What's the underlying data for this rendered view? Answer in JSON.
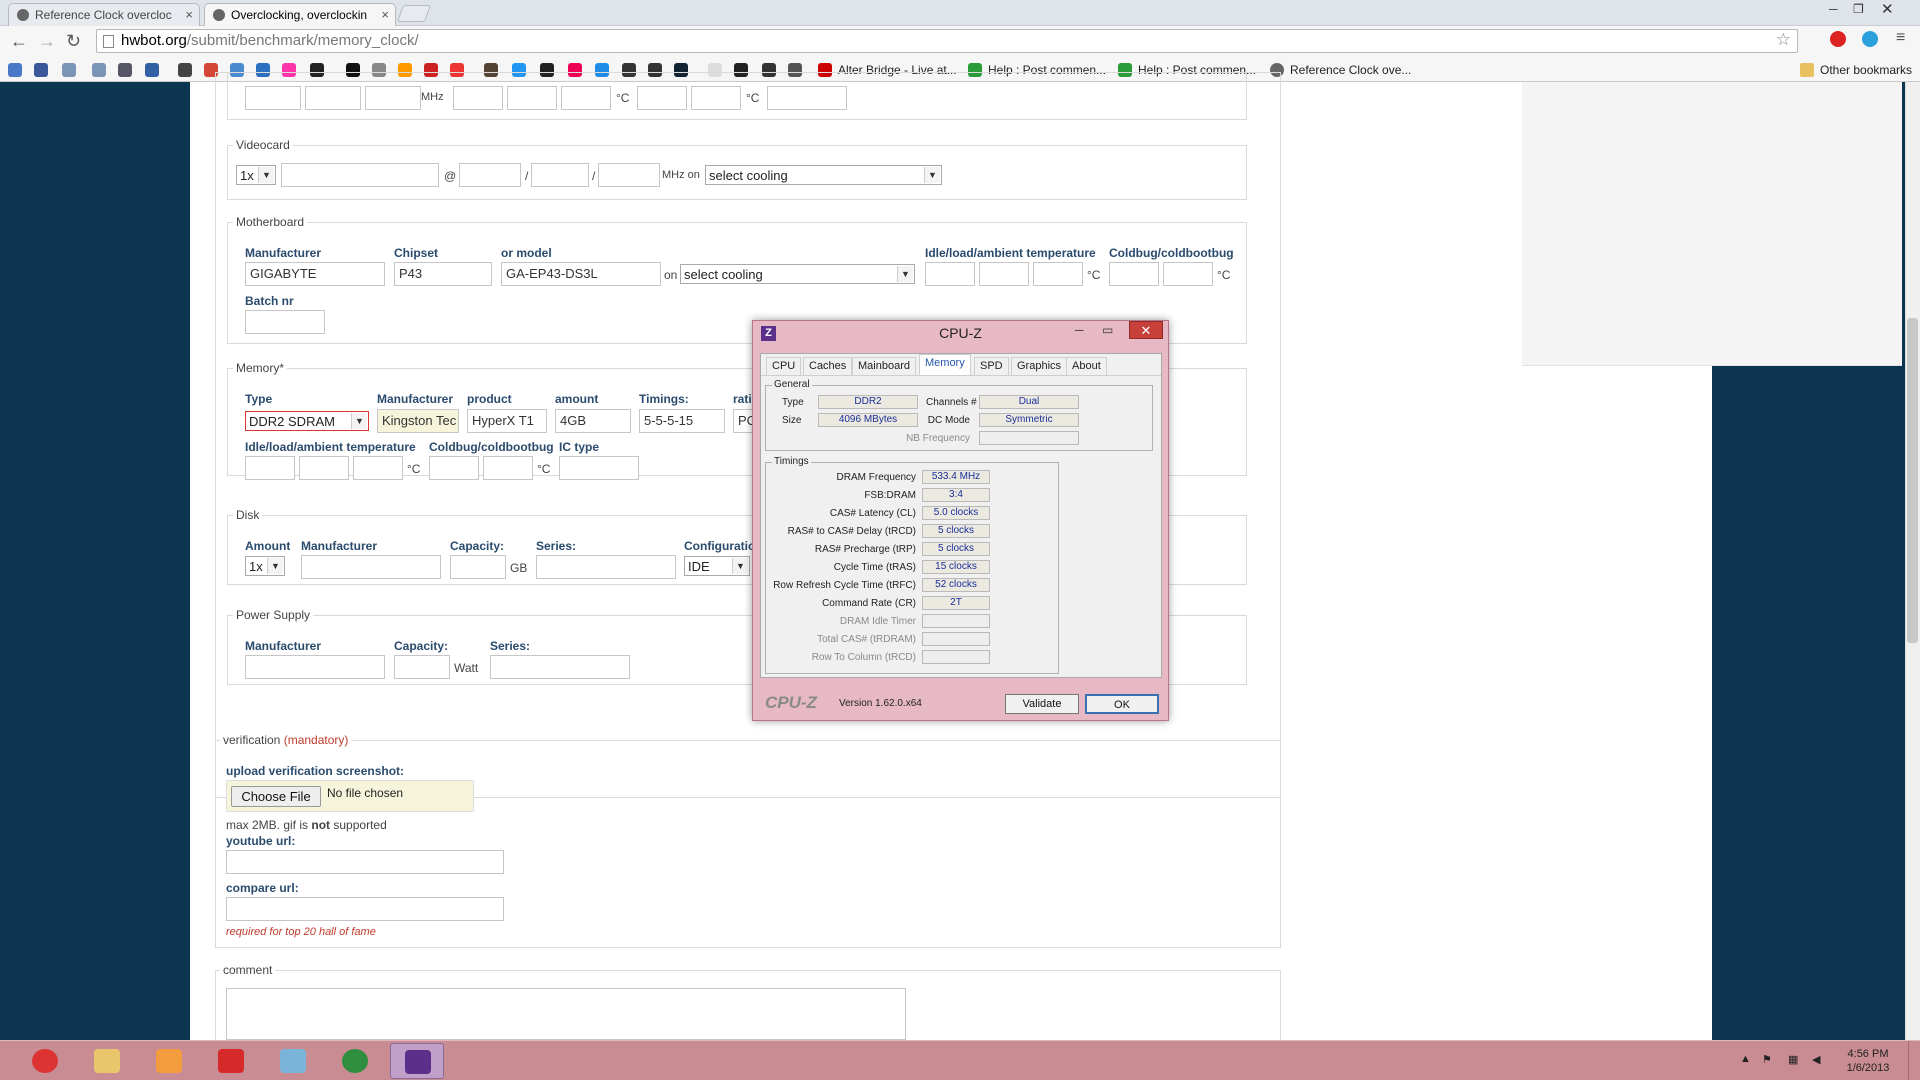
{
  "browser": {
    "tabs": [
      {
        "title": "Reference Clock overcloc"
      },
      {
        "title": "Overclocking, overclockin"
      }
    ],
    "url": {
      "host": "hwbot.org",
      "path": "/submit/benchmark/memory_clock/"
    },
    "bookmarks": [
      {
        "label": "Alter Bridge - Live at..."
      },
      {
        "label": "Help : Post commen..."
      },
      {
        "label": "Help : Post commen..."
      },
      {
        "label": "Reference Clock ove..."
      }
    ],
    "other_bookmarks": "Other bookmarks"
  },
  "form": {
    "top_row": {
      "unit1": "MHz",
      "unit2": "°C",
      "unit3": "°C"
    },
    "videocard": {
      "legend": "Videocard",
      "count": "1x",
      "at": "@",
      "sep1": "/",
      "sep2": "/",
      "unit": "MHz on",
      "cooling": "select cooling"
    },
    "motherboard": {
      "legend": "Motherboard",
      "manufacturer_label": "Manufacturer",
      "manufacturer_value": "GIGABYTE",
      "chipset_label": "Chipset",
      "chipset_value": "P43",
      "model_label": "or model",
      "model_value": "GA-EP43-DS3L",
      "on": "on",
      "cooling": "select cooling",
      "temp_label": "Idle/load/ambient temperature",
      "temp_unit": "°C",
      "coldbug_label": "Coldbug/coldbootbug",
      "coldbug_unit": "°C",
      "batch_label": "Batch nr"
    },
    "memory": {
      "legend": "Memory*",
      "type_label": "Type",
      "type_value": "DDR2 SDRAM",
      "manufacturer_label": "Manufacturer",
      "manufacturer_value": "Kingston Tec",
      "product_label": "product",
      "product_value": "HyperX T1",
      "amount_label": "amount",
      "amount_value": "4GB",
      "timings_label": "Timings:",
      "timings_value": "5-5-5-15",
      "ratio_label": "rati",
      "ratio_value": "PC",
      "temp_label": "Idle/load/ambient temperature",
      "temp_unit": "°C",
      "coldbug_label": "Coldbug/coldbootbug",
      "coldbug_unit": "°C",
      "ic_label": "IC type"
    },
    "disk": {
      "legend": "Disk",
      "amount_label": "Amount",
      "amount_value": "1x",
      "manufacturer_label": "Manufacturer",
      "capacity_label": "Capacity:",
      "capacity_unit": "GB",
      "series_label": "Series:",
      "config_label": "Configuratio",
      "config_value": "IDE"
    },
    "psu": {
      "legend": "Power Supply",
      "manufacturer_label": "Manufacturer",
      "capacity_label": "Capacity:",
      "capacity_unit": "Watt",
      "series_label": "Series:"
    },
    "verification": {
      "legend": "verification",
      "mandatory": "(mandatory)",
      "upload_label": "upload verification screenshot:",
      "choose_file": "Choose File",
      "no_file": "No file chosen",
      "note_prefix": "max 2MB. gif is",
      "note_bold": "not",
      "note_suffix": "supported",
      "youtube_label": "youtube url:",
      "compare_label": "compare url:",
      "compare_note": "required for top 20 hall of fame"
    },
    "comment": {
      "legend": "comment"
    }
  },
  "cpuz": {
    "title": "CPU-Z",
    "tabs": [
      "CPU",
      "Caches",
      "Mainboard",
      "Memory",
      "SPD",
      "Graphics",
      "About"
    ],
    "active_tab": "Memory",
    "general": {
      "legend": "General",
      "type_label": "Type",
      "type_value": "DDR2",
      "size_label": "Size",
      "size_value": "4096 MBytes",
      "channels_label": "Channels #",
      "channels_value": "Dual",
      "dcmode_label": "DC Mode",
      "dcmode_value": "Symmetric",
      "nbfreq_label": "NB Frequency"
    },
    "timings": {
      "legend": "Timings",
      "rows": [
        {
          "label": "DRAM Frequency",
          "value": "533.4 MHz"
        },
        {
          "label": "FSB:DRAM",
          "value": "3:4"
        },
        {
          "label": "CAS# Latency (CL)",
          "value": "5.0 clocks"
        },
        {
          "label": "RAS# to CAS# Delay (tRCD)",
          "value": "5 clocks"
        },
        {
          "label": "RAS# Precharge (tRP)",
          "value": "5 clocks"
        },
        {
          "label": "Cycle Time (tRAS)",
          "value": "15 clocks"
        },
        {
          "label": "Row Refresh Cycle Time (tRFC)",
          "value": "52 clocks"
        },
        {
          "label": "Command Rate (CR)",
          "value": "2T"
        },
        {
          "label": "DRAM Idle Timer",
          "value": ""
        },
        {
          "label": "Total CAS# (tRDRAM)",
          "value": ""
        },
        {
          "label": "Row To Column (tRCD)",
          "value": ""
        }
      ]
    },
    "brand": "CPU-Z",
    "version": "Version 1.62.0.x64",
    "validate": "Validate",
    "ok": "OK"
  },
  "taskbar": {
    "time": "4:56 PM",
    "date": "1/6/2013"
  },
  "colors": {
    "page_bg": "#0b3550",
    "label_blue": "#2a4b6d",
    "required_red": "#c0392b",
    "taskbar": "#c98c93"
  }
}
